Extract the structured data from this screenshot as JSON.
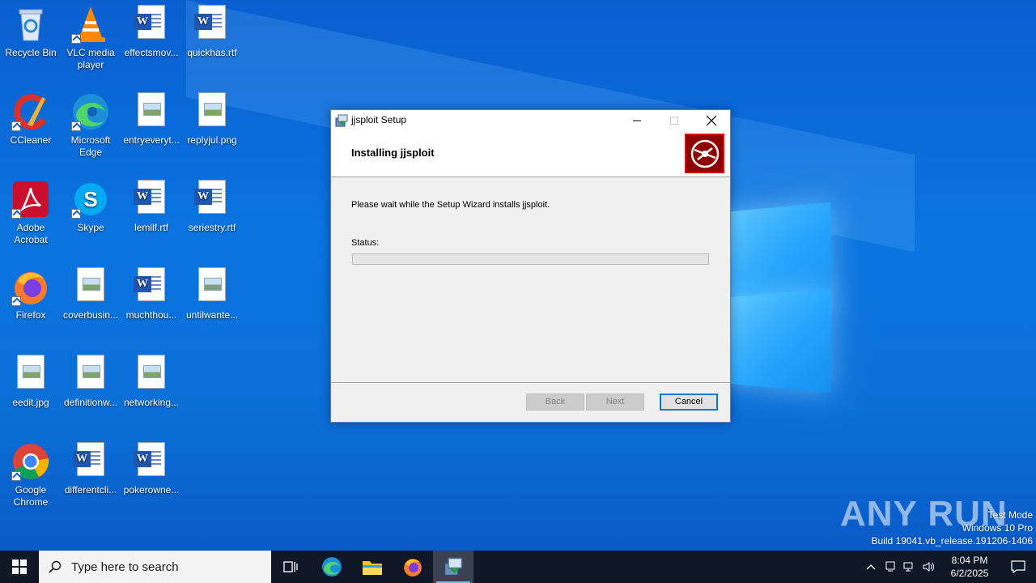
{
  "desktop": {
    "icons": [
      {
        "label": "Recycle Bin"
      },
      {
        "label": "VLC media player"
      },
      {
        "label": "effectsmov..."
      },
      {
        "label": "quickhas.rtf"
      },
      {
        "label": "CCleaner"
      },
      {
        "label": "Microsoft Edge"
      },
      {
        "label": "entryeveryt..."
      },
      {
        "label": "replyjul.png"
      },
      {
        "label": "Adobe Acrobat"
      },
      {
        "label": "Skype"
      },
      {
        "label": "lemilf.rtf"
      },
      {
        "label": "seriestry.rtf"
      },
      {
        "label": "Firefox"
      },
      {
        "label": "coverbusin..."
      },
      {
        "label": "muchthou..."
      },
      {
        "label": "untilwante..."
      },
      {
        "label": "eedit.jpg"
      },
      {
        "label": "definitionw..."
      },
      {
        "label": "networking..."
      },
      {
        "label": "Google Chrome"
      },
      {
        "label": "differentcli..."
      },
      {
        "label": "pokerowne..."
      }
    ]
  },
  "dialog": {
    "title": "jjsploit Setup",
    "heading": "Installing jjsploit",
    "message": "Please wait while the Setup Wizard installs jjsploit.",
    "status_label": "Status:",
    "progress": 0,
    "back_label": "Back",
    "next_label": "Next",
    "cancel_label": "Cancel"
  },
  "watermark": {
    "brand": "ANY RUN",
    "line1": "Test Mode",
    "line2": "Windows 10 Pro",
    "line3": "Build 19041.vb_release.191206-1406"
  },
  "taskbar": {
    "search_placeholder": "Type here to search",
    "time": "8:04 PM",
    "date": "6/2/2025"
  },
  "colors": {
    "accent": "#0078d7",
    "taskbar": "#101827",
    "desktop": "#0a6fdc",
    "logo_red": "#8e0000"
  }
}
